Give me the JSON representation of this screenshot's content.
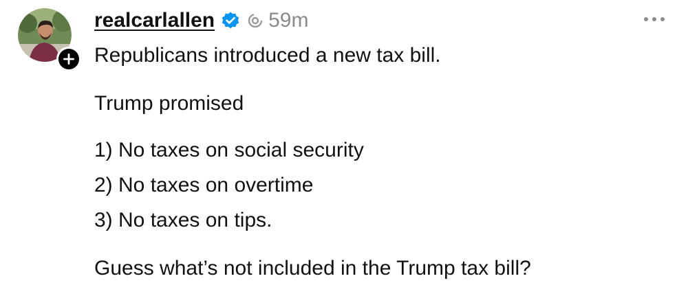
{
  "post": {
    "author": {
      "username": "realcarlallen",
      "verified": true,
      "avatar_icon": "profile-photo",
      "follow_icon": "plus-icon"
    },
    "timestamp": "59m",
    "more_icon": "ellipsis-icon",
    "activity_icon": "threads-activity-icon",
    "lines": [
      "Republicans introduced a new tax bill.",
      "Trump promised",
      "1) No taxes on social security",
      "2) No taxes on overtime",
      "3) No taxes on tips.",
      "Guess what’s not included in the Trump tax bill?"
    ]
  },
  "colors": {
    "text": "#111111",
    "muted": "#8a8a8a",
    "verified": "#0095f6",
    "badge": "#000000"
  }
}
